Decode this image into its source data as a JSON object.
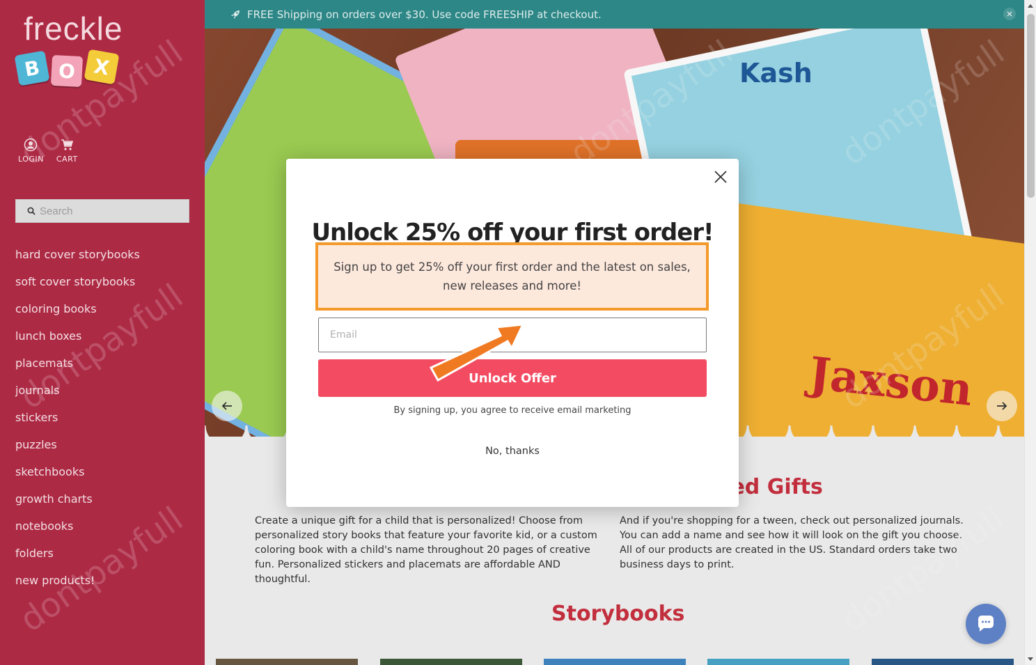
{
  "logo": {
    "word": "freckle",
    "blocks": [
      "B",
      "O",
      "X"
    ]
  },
  "user_links": [
    {
      "label": "LOGIN",
      "icon": "user-circle-icon"
    },
    {
      "label": "CART",
      "icon": "cart-icon"
    }
  ],
  "search": {
    "placeholder": "Search",
    "value": ""
  },
  "nav": [
    "hard cover storybooks",
    "soft cover storybooks",
    "coloring books",
    "lunch boxes",
    "placemats",
    "journals",
    "stickers",
    "puzzles",
    "sketchbooks",
    "growth charts",
    "notebooks",
    "folders",
    "new products!"
  ],
  "banner": {
    "text": "FREE Shipping on orders over $30. Use code FREESHIP at checkout.",
    "icon": "rocket-icon",
    "close_icon": "close-icon"
  },
  "hero": {
    "names": [
      "Kash",
      "Jaxson"
    ],
    "prev_icon": "arrow-left-icon",
    "next_icon": "arrow-right-icon"
  },
  "content": {
    "section_title_partial": "zed Gifts",
    "left_paragraph": "Create a unique gift for a child that is personalized! Choose from personalized story books that feature your favorite kid, or a custom coloring book with a child's name throughout 20 pages of creative fun. Personalized stickers and placemats are affordable AND thoughtful.",
    "right_paragraph": "And if you're shopping for a tween, check out personalized journals. You can add a name and see how it will look on the gift you choose. All of our products are created in the US. Standard orders take two business days to print.",
    "storybooks_title": "Storybooks"
  },
  "modal": {
    "title": "Unlock 25% off your first order!",
    "subtitle": "Sign up to get 25% off your first order and the latest on sales, new releases and more!",
    "email_placeholder": "Email",
    "button": "Unlock Offer",
    "consent": "By signing up, you agree to receive email marketing",
    "decline": "No, thanks",
    "close_icon": "close-icon"
  },
  "watermark": "dontpayfull",
  "chat_icon": "chat-bubble-icon",
  "colors": {
    "sidebar": "#ad2a45",
    "banner": "#2f8c8c",
    "accent": "#f34c62",
    "highlight_border": "#f39a2a",
    "section_title": "#c9303f"
  }
}
